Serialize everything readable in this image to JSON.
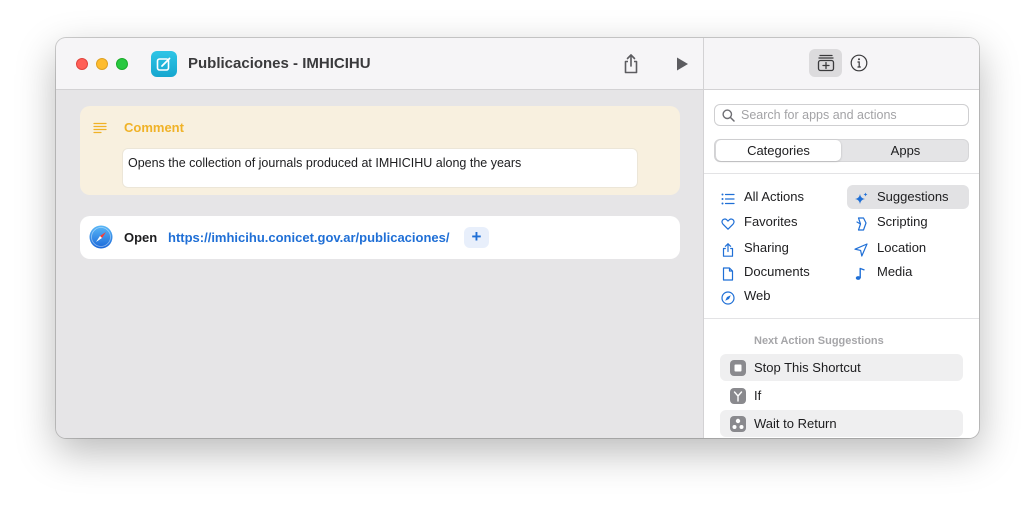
{
  "window": {
    "title": "Publicaciones - IMHICIHU"
  },
  "editor": {
    "comment": {
      "label": "Comment",
      "text": "Opens the collection of journals produced at IMHICIHU along the years"
    },
    "open_action": {
      "label": "Open",
      "url": "https://imhicihu.conicet.gov.ar/publicaciones/",
      "plus": "+"
    }
  },
  "library": {
    "search_placeholder": "Search for apps and actions",
    "tabs": {
      "categories": "Categories",
      "apps": "Apps",
      "selected": "Categories"
    },
    "categories": [
      {
        "label": "All Actions",
        "icon": "list-icon"
      },
      {
        "label": "Suggestions",
        "icon": "sparkles-icon",
        "selected": true
      },
      {
        "label": "Favorites",
        "icon": "heart-icon"
      },
      {
        "label": "Scripting",
        "icon": "scripting-icon"
      },
      {
        "label": "Sharing",
        "icon": "share-icon"
      },
      {
        "label": "Location",
        "icon": "location-arrow-icon"
      },
      {
        "label": "Documents",
        "icon": "document-icon"
      },
      {
        "label": "Media",
        "icon": "music-note-icon"
      },
      {
        "label": "Web",
        "icon": "compass-icon"
      }
    ],
    "suggestions_header": "Next Action Suggestions",
    "suggestions": [
      {
        "label": "Stop This Shortcut",
        "icon": "stop-icon"
      },
      {
        "label": "If",
        "icon": "branch-icon"
      },
      {
        "label": "Wait to Return",
        "icon": "wait-icon"
      }
    ]
  },
  "colors": {
    "accent": "#1f6fd6",
    "comment_label": "#f0b227",
    "comment_bg": "#f8f0df",
    "app_icon": "#16a6cf"
  }
}
